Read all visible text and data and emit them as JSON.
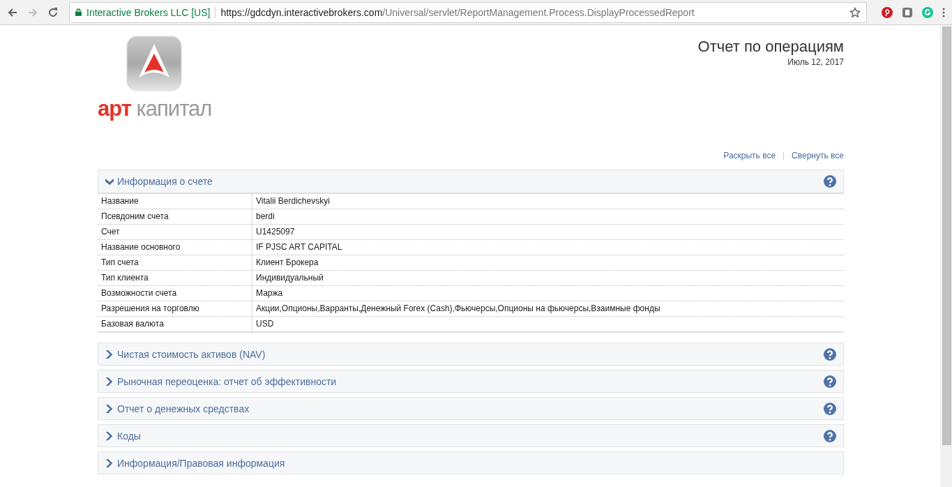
{
  "browser": {
    "site_identity": "Interactive Brokers LLC [US]",
    "url_host": "https://gdcdyn.interactivebrokers.com",
    "url_path": "/Universal/servlet/ReportManagement.Process.DisplayProcessedReport",
    "forward_disabled": true
  },
  "logo": {
    "word_1": "арт",
    "word_2": "капитал"
  },
  "report": {
    "title": "Отчет по операциям",
    "date": "Июль 12, 2017"
  },
  "toolbar_links": [
    "Раскрыть все",
    "Свернуть все"
  ],
  "sections": [
    {
      "title": "Информация о счете",
      "expanded": true,
      "help": true,
      "rows": [
        {
          "label": "Название",
          "value": "Vitalii Berdichevskyi"
        },
        {
          "label": "Псевдоним счета",
          "value": "berdi"
        },
        {
          "label": "Счет",
          "value": "U1425097"
        },
        {
          "label": "Название основного",
          "value": "IF PJSC ART CAPITAL"
        },
        {
          "label": "Тип счета",
          "value": "Клиент Брокера"
        },
        {
          "label": "Тип клиента",
          "value": "Индивидуальный"
        },
        {
          "label": "Возможности счета",
          "value": "Маржа"
        },
        {
          "label": "Разрешения на торговлю",
          "value": "Акции,Опционы,Варранты,Денежный Forex (Cash),Фьючерсы,Опционы на фьючерсы,Взаимные фонды"
        },
        {
          "label": "Базовая валюта",
          "value": "USD"
        }
      ]
    },
    {
      "title": "Чистая стоимость активов (NAV)",
      "expanded": false,
      "help": true
    },
    {
      "title": "Рыночная переоценка: отчет об эффективности",
      "expanded": false,
      "help": true
    },
    {
      "title": "Отчет о денежных средствах",
      "expanded": false,
      "help": true
    },
    {
      "title": "Коды",
      "expanded": false,
      "help": true
    },
    {
      "title": "Информация/Правовая информация",
      "expanded": false,
      "help": false
    }
  ]
}
